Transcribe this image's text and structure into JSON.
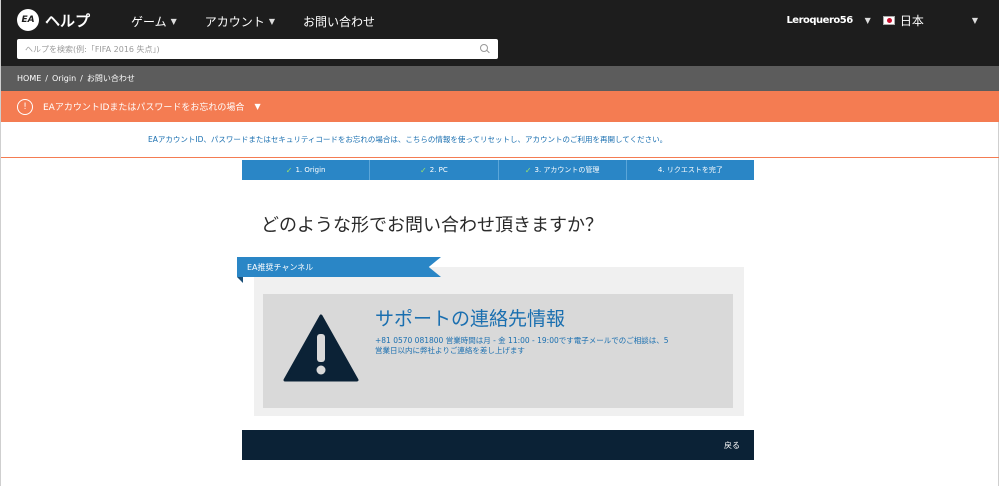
{
  "header": {
    "logo_text": "ヘルプ",
    "logo_badge": "EA",
    "nav": [
      {
        "label": "ゲーム",
        "dropdown": true
      },
      {
        "label": "アカウント",
        "dropdown": true
      },
      {
        "label": "お問い合わせ",
        "dropdown": false
      }
    ],
    "username": "Leroquero56",
    "language": "日本",
    "search_placeholder": "ヘルプを検索(例:「FIFA 2016 失点」)"
  },
  "breadcrumb": [
    "HOME",
    "Origin",
    "お問い合わせ"
  ],
  "alert": {
    "icon": "!",
    "text": "EAアカウントIDまたはパスワードをお忘れの場合"
  },
  "info_text": "EAアカウントID、パスワードまたはセキュリティコードをお忘れの場合は、こちらの情報を使ってリセットし、アカウントのご利用を再開してください。",
  "steps": [
    {
      "label": "1. Origin",
      "done": true
    },
    {
      "label": "2. PC",
      "done": true
    },
    {
      "label": "3. アカウントの管理",
      "done": true
    },
    {
      "label": "4. リクエストを完了",
      "done": false
    }
  ],
  "question": "どのような形でお問い合わせ頂きますか？",
  "channel": {
    "tag": "EA推奨チャンネル",
    "title": "サポートの連絡先情報",
    "description": "+81 0570 081800 営業時間は月 - 金 11:00 - 19:00です電子メールでのご相談は、5 営業日以内に弊社よりご連絡を差し上げます"
  },
  "footer": {
    "back_label": "戻る"
  },
  "colors": {
    "header_bg": "#1d1d1d",
    "breadcrumb_bg": "#5c5c5c",
    "alert_bg": "#f47c52",
    "step_bg": "#2a86c6",
    "footer_bg": "#0b2236",
    "link_blue": "#1a6fb0"
  }
}
